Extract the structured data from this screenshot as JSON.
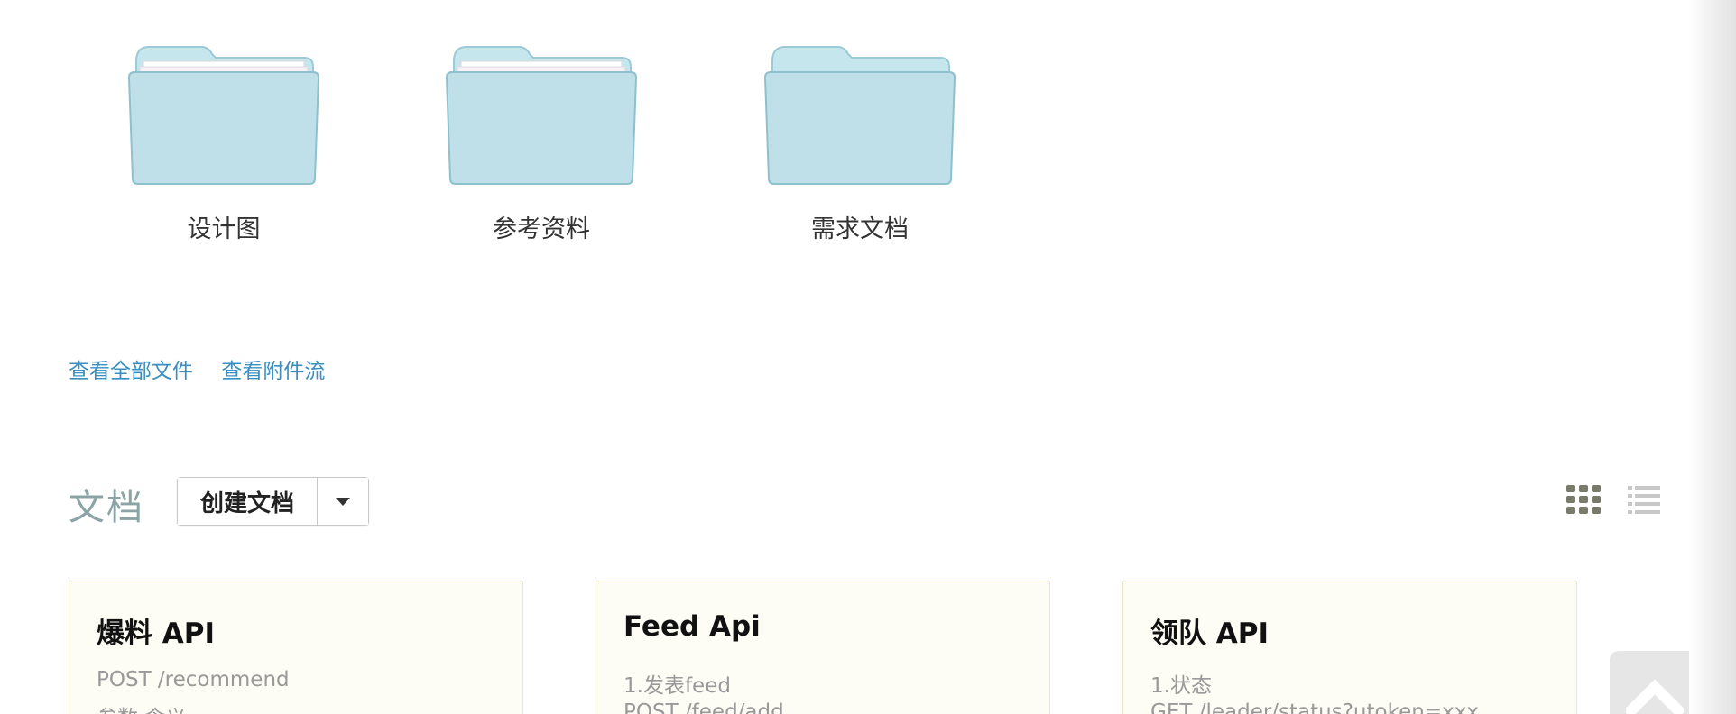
{
  "folders": [
    {
      "label": "设计图",
      "has_papers": true,
      "icon": "folder-icon"
    },
    {
      "label": "参考资料",
      "has_papers": true,
      "icon": "folder-icon"
    },
    {
      "label": "需求文档",
      "has_papers": false,
      "icon": "folder-icon"
    }
  ],
  "links": {
    "all_files": "查看全部文件",
    "attachment_stream": "查看附件流"
  },
  "docs_section": {
    "title": "文档",
    "create_label": "创建文档",
    "dropdown_icon": "caret-down-icon",
    "view_grid_icon": "grid-view-icon",
    "view_list_icon": "list-view-icon"
  },
  "cards": [
    {
      "title": "爆料 API",
      "line1": "POST  /recommend",
      "line2": "参数                  含义"
    },
    {
      "title": "Feed Api",
      "line1": "1.发表feed",
      "line2": "POST  /feed/add"
    },
    {
      "title": "领队 API",
      "line1": "1.状态",
      "line2": "GET  /leader/status?utoken=xxx"
    }
  ],
  "back_to_top_icon": "chevron-up-icon",
  "colors": {
    "link": "#3a8fc0",
    "section_title": "#8aa3a3",
    "card_bg": "#fdfdf5",
    "folder": "#bde0ea"
  }
}
